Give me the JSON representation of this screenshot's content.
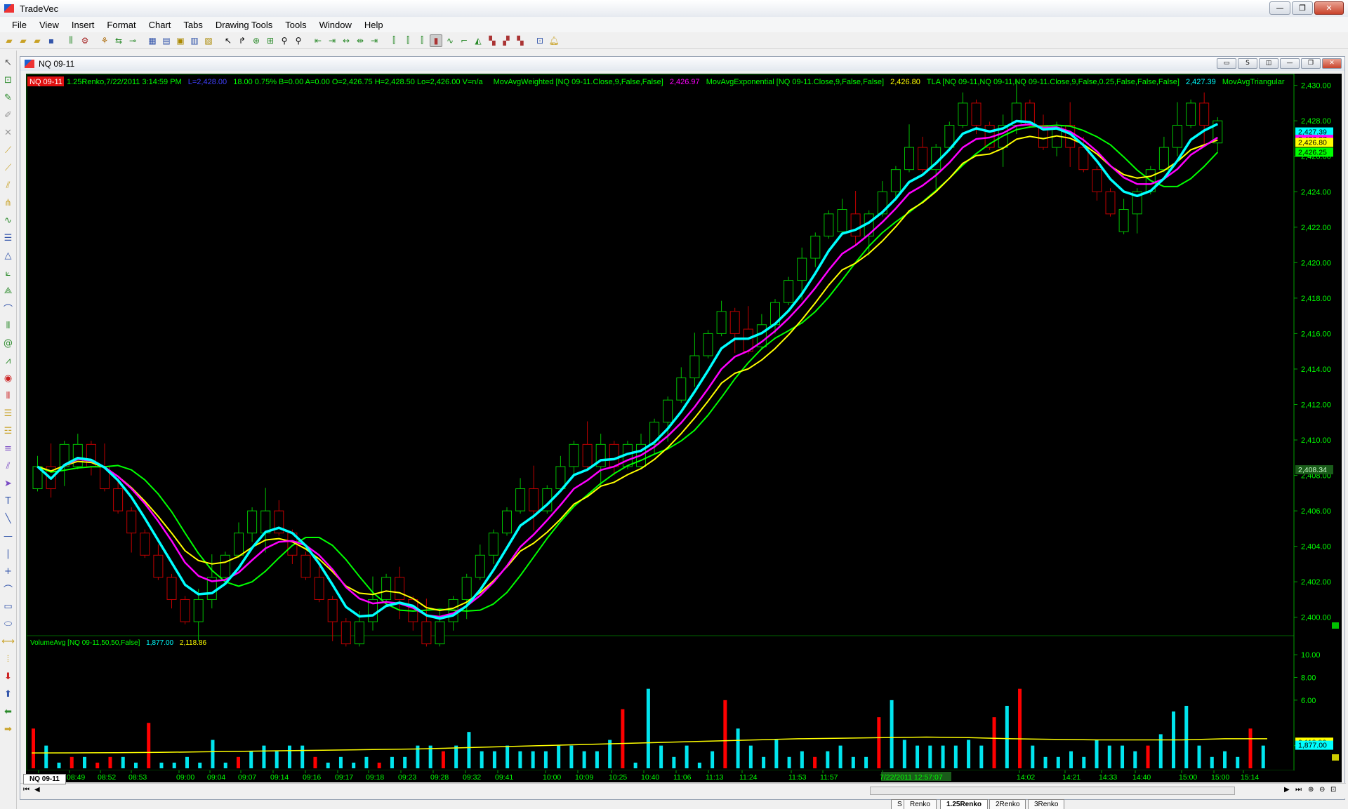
{
  "app": {
    "title": "TradeVec",
    "menu": [
      "File",
      "View",
      "Insert",
      "Format",
      "Chart",
      "Tabs",
      "Drawing Tools",
      "Tools",
      "Window",
      "Help"
    ]
  },
  "chart_window": {
    "title": "NQ 09-11",
    "tab_label": "NQ 09-11"
  },
  "header_line": {
    "symbol_badge": "NQ 09-11",
    "info": "1.25Renko,7/22/2011 3:14:59 PM",
    "last": "L=2,428.00",
    "change": "18.00  0.75%  B=0.00  A=0.00  O=2,426.75  H=2,428.50  Lo=2,426.00  V=n/a",
    "wma_label": "MovAvgWeighted  [NQ 09-11.Close,9,False,False]",
    "wma_value": "2,426.97",
    "ema_label": "MovAvgExponential  [NQ 09-11.Close,9,False,False]",
    "ema_value": "2,426.80",
    "tla_label": "TLA  [NQ 09-11,NQ 09-11,NQ 09-11.Close,9,False,0.25,False,False,False]",
    "tla_value": "2,427.39",
    "tri_label": "MovAvgTriangular"
  },
  "volume_header": {
    "label": "VolumeAvg  [NQ 09-11,50,50,False]",
    "value1": "1,877.00",
    "value2": "2,118.86"
  },
  "price_axis_labels": [
    "2,430.00",
    "2,428.00",
    "2,426.00",
    "2,424.00",
    "2,422.00",
    "2,420.00",
    "2,418.00",
    "2,416.00",
    "2,414.00",
    "2,412.00",
    "2,410.00",
    "2,408.00",
    "2,406.00",
    "2,404.00",
    "2,402.00",
    "2,400.00"
  ],
  "price_tags": [
    {
      "text": "2,427.39",
      "color": "#00ffff"
    },
    {
      "text": "2,426.97",
      "color": "#ff00ff"
    },
    {
      "text": "2,426.80",
      "color": "#ffff00"
    },
    {
      "text": "2,426.25",
      "color": "#00ff00"
    },
    {
      "text": "2,408.34",
      "color": "#1a5c1a"
    }
  ],
  "volume_axis_labels": [
    "10.00",
    "8.00",
    "6.00",
    "2.00"
  ],
  "volume_tags": [
    {
      "text": "2,118.86",
      "color": "#ffff00"
    },
    {
      "text": "1,877.00",
      "color": "#00ffff"
    }
  ],
  "time_labels": [
    "08:46",
    "08:49",
    "08:52",
    "08:53",
    "09:00",
    "09:04",
    "09:07",
    "09:14",
    "09:16",
    "09:17",
    "09:18",
    "09:23",
    "09:28",
    "09:32",
    "09:41",
    "10:00",
    "10:09",
    "10:25",
    "10:40",
    "11:06",
    "11:13",
    "11:24",
    "11:53",
    "11:57",
    "7/22/2011 12:57:07",
    "14:02",
    "14:21",
    "14:33",
    "14:40",
    "15:00",
    "15:00",
    "15:14"
  ],
  "bottom_tabs": [
    "S",
    "Renko",
    "1.25Renko",
    "2Renko",
    "3Renko"
  ],
  "colors": {
    "up": "#00c000",
    "down": "#c00000",
    "wma": "#ff00ff",
    "ema": "#ffff00",
    "tla": "#00ffff",
    "tri": "#00ff00",
    "volume_up": "#00e5ee",
    "volume_down": "#ff0000",
    "grid_frame": "#006400"
  },
  "chart_data": [
    {
      "type": "candlestick",
      "series": [
        {
          "name": "NQ 09-11",
          "close": [
            2408.5,
            2407.25,
            2409.75,
            2409.75,
            2408.5,
            2407.25,
            2406.0,
            2404.75,
            2403.5,
            2402.25,
            2401.0,
            2399.75,
            2401.0,
            2402.25,
            2403.5,
            2404.75,
            2406.0,
            2406.0,
            2404.75,
            2403.5,
            2402.25,
            2401.0,
            2399.75,
            2398.5,
            2399.75,
            2401.0,
            2402.25,
            2401.0,
            2399.75,
            2398.5,
            2399.75,
            2401.0,
            2402.25,
            2403.5,
            2404.75,
            2406.0,
            2407.25,
            2406.0,
            2407.25,
            2408.5,
            2409.75,
            2408.5,
            2409.75,
            2408.5,
            2409.75,
            2409.75,
            2411.0,
            2412.25,
            2413.5,
            2414.75,
            2416.0,
            2417.25,
            2416.0,
            2415.0,
            2416.5,
            2417.75,
            2419.0,
            2420.25,
            2421.5,
            2422.75,
            2423.0,
            2421.5,
            2422.75,
            2424.0,
            2425.25,
            2426.5,
            2425.25,
            2426.5,
            2427.75,
            2429.0,
            2427.75,
            2426.5,
            2427.75,
            2429.0,
            2427.75,
            2426.5,
            2427.75,
            2426.5,
            2425.25,
            2424.0,
            2422.75,
            2423.0,
            2424.0,
            2425.25,
            2426.5,
            2427.75,
            2429.0,
            2427.75,
            2428.0
          ]
        }
      ],
      "ylim": [
        2399,
        2430.5
      ]
    },
    {
      "type": "bar",
      "series": [
        {
          "name": "Volume",
          "values": [
            3.5,
            2,
            0.5,
            1,
            1,
            0.5,
            1,
            1,
            0.5,
            4,
            0.5,
            0.5,
            1,
            0.5,
            2.5,
            0.5,
            1,
            1.5,
            2,
            1.5,
            2,
            2,
            1,
            0.5,
            1,
            0.5,
            1,
            0.5,
            1,
            1,
            2,
            2,
            1.5,
            2,
            3.2,
            1.5,
            1.5,
            2,
            1.5,
            1.5,
            1.5,
            2,
            2,
            1.5,
            1.5,
            2.5,
            5.2,
            0.5,
            7,
            2,
            1,
            2,
            0.5,
            1.5,
            6,
            3.5,
            2,
            1,
            2.5,
            1,
            1.5,
            1,
            1.5,
            2,
            1,
            1,
            4.5,
            6,
            2.5,
            2,
            2,
            2,
            2,
            2.5,
            2,
            4.5,
            5.5,
            7,
            2,
            1,
            1,
            1.5,
            1,
            2.5,
            2,
            2,
            1.5,
            2,
            3,
            5,
            5.5,
            2,
            1,
            1.5,
            1,
            3.5,
            2
          ]
        },
        {
          "name": "VolumeAvg",
          "values": [
            1.35,
            1.36,
            1.37,
            1.4,
            1.45,
            1.5,
            1.55,
            1.6,
            1.65,
            1.7,
            1.8,
            1.9,
            2.0,
            2.1,
            2.2,
            2.3,
            2.4,
            2.5,
            2.6,
            2.65,
            2.7,
            2.75,
            2.7,
            2.6,
            2.55,
            2.5,
            2.5,
            2.5,
            2.6,
            2.6
          ]
        }
      ],
      "ylim": [
        0,
        10.5
      ]
    }
  ]
}
